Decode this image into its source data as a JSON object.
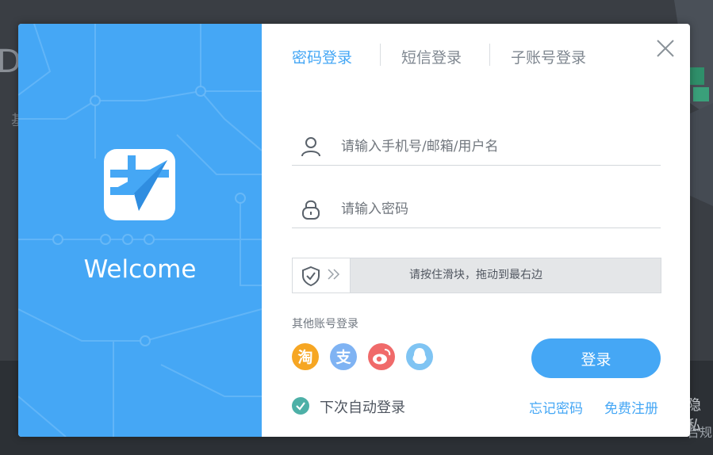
{
  "background": {
    "letter": "D",
    "char": "基",
    "right_text_a": "隐私",
    "right_text_b": "合规"
  },
  "left_panel": {
    "welcome": "Welcome",
    "color": "#45a7f5"
  },
  "tabs": [
    {
      "label": "密码登录",
      "active": true
    },
    {
      "label": "短信登录",
      "active": false
    },
    {
      "label": "子账号登录",
      "active": false
    }
  ],
  "form": {
    "username_placeholder": "请输入手机号/邮箱/用户名",
    "password_placeholder": "请输入密码"
  },
  "slider": {
    "text": "请按住滑块，拖动到最右边"
  },
  "other_login": {
    "label": "其他账号登录",
    "icons": [
      {
        "name": "taobao-icon",
        "glyph": "淘",
        "color": "#f6a623"
      },
      {
        "name": "alipay-icon",
        "glyph": "支",
        "color": "#7fb3f3"
      },
      {
        "name": "weibo-icon",
        "glyph": "",
        "color": "#f06a6a"
      },
      {
        "name": "qq-icon",
        "glyph": "",
        "color": "#7fc4f3"
      }
    ]
  },
  "login_button": "登录",
  "remember": "下次自动登录",
  "links": {
    "forgot": "忘记密码",
    "register": "免费注册"
  }
}
